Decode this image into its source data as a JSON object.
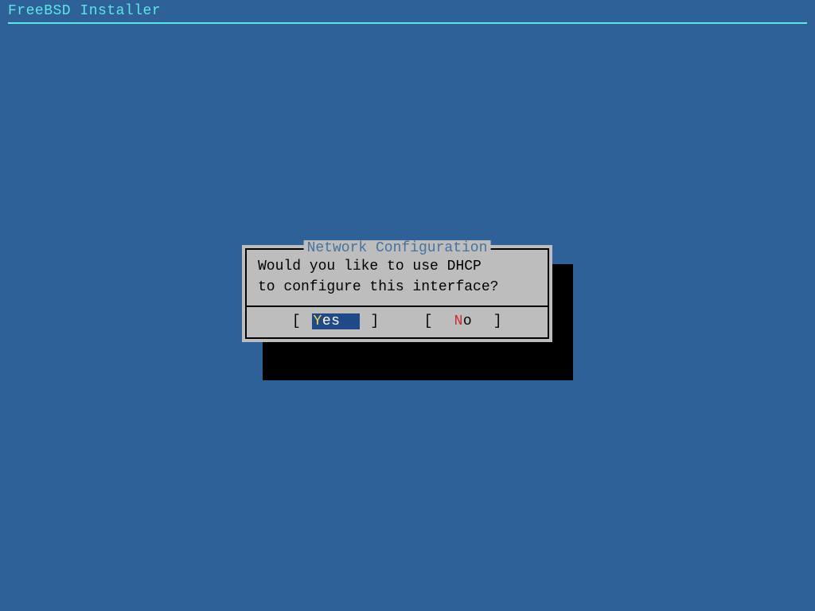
{
  "header": {
    "title": "FreeBSD Installer"
  },
  "dialog": {
    "title": "Network Configuration",
    "message": "Would you like to use DHCP\nto configure this interface?",
    "buttons": {
      "yes": {
        "hotkey": "Y",
        "rest": "es",
        "selected": true
      },
      "no": {
        "hotkey": "N",
        "rest": "o",
        "selected": false
      }
    }
  }
}
